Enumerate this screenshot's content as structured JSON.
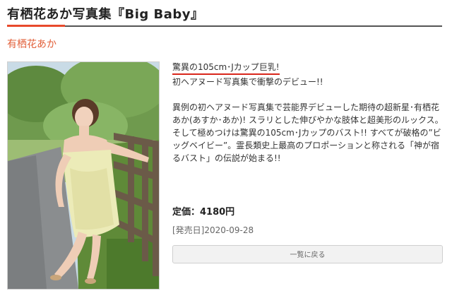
{
  "page": {
    "title": "有栖花あか写真集『Big Baby』",
    "author": "有栖花あか"
  },
  "product": {
    "headline": "驚異の105cm･Jカップ巨乳!",
    "subheadline": "初ヘアヌード写真集で衝撃のデビュー!!",
    "description": "異例の初ヘアヌード写真集で芸能界デビューした期待の超新星･有栖花あか(あすか･あか)! スラリとした伸びやかな肢体と超美形のルックス。そして極めつけは驚異の105cm･Jカップのバスト!! すべてが破格の”ビッグベイビー”。霊長類史上最高のプロポーションと称される「神が宿るバスト」の伝説が始まる!!",
    "price": "定価：4180円",
    "release_date": "[発売日]2020-09-28"
  },
  "navigation": {
    "back_label": "一覧に戻る"
  },
  "colors": {
    "accent": "#e84a2c",
    "author": "#e2603a",
    "underline": "#d9261c"
  }
}
